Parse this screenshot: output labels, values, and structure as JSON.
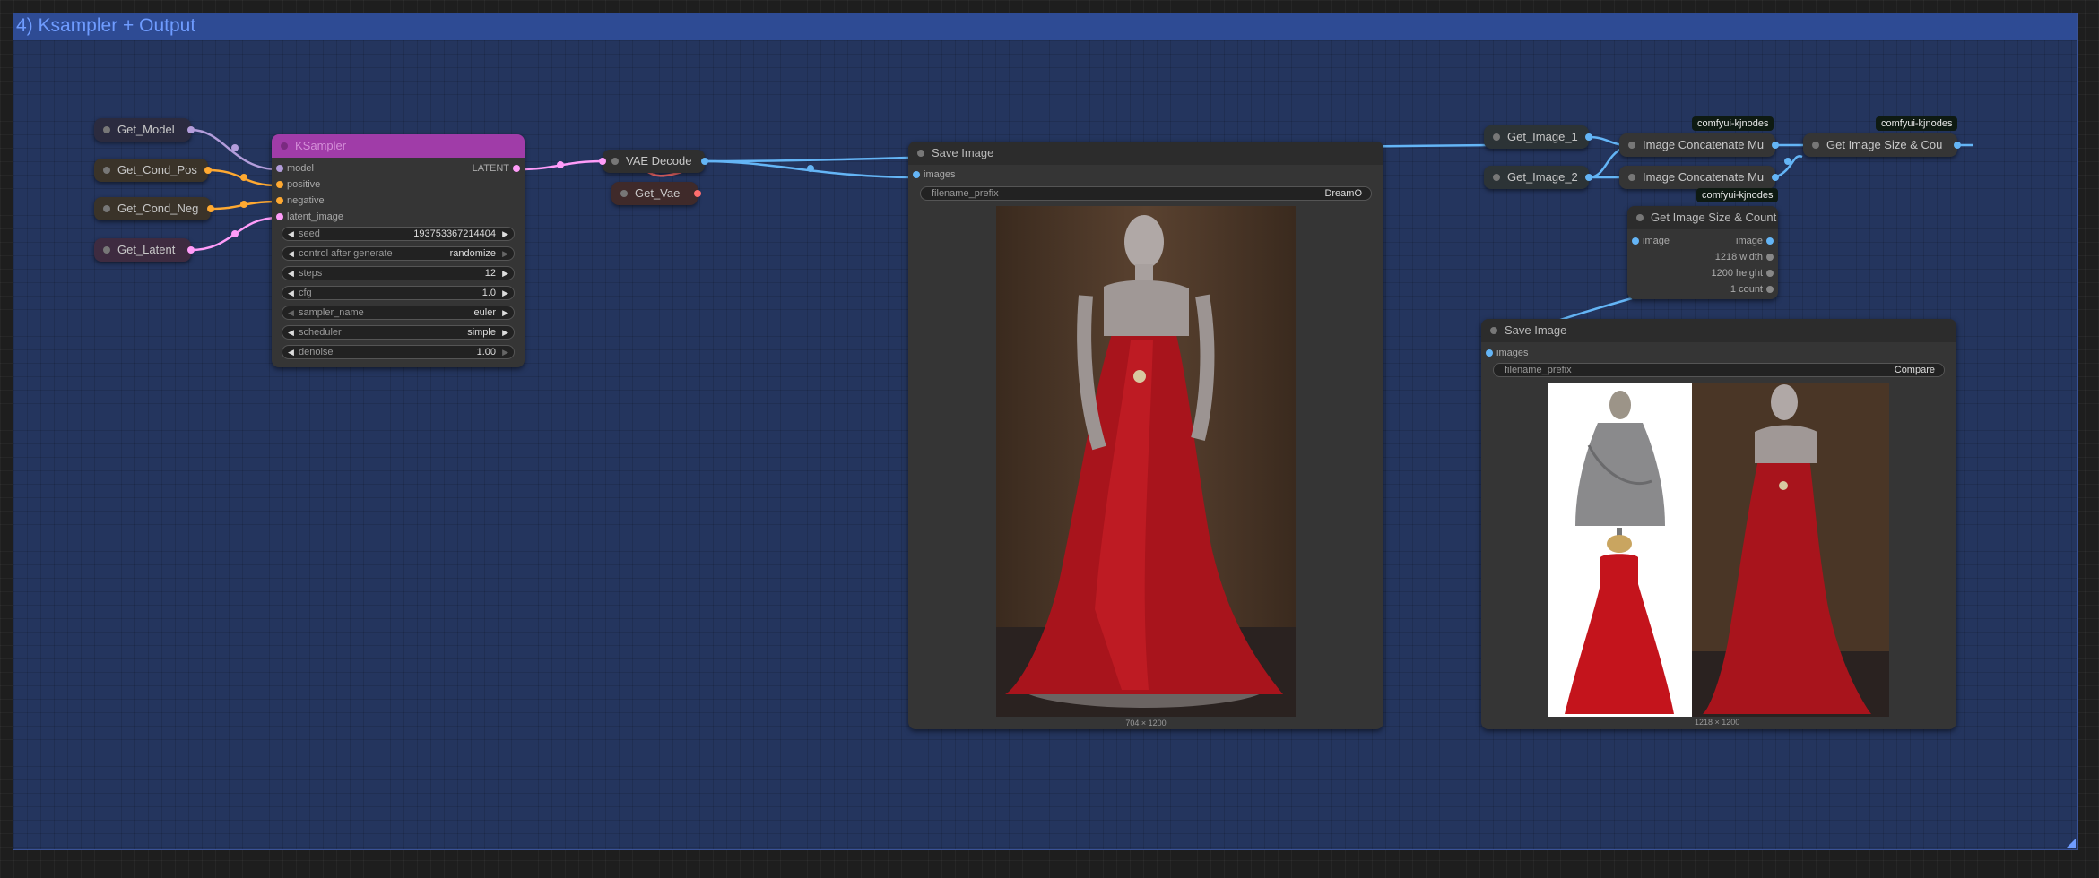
{
  "group": {
    "title": "4) Ksampler + Output"
  },
  "get_nodes": {
    "model": "Get_Model",
    "cond_pos": "Get_Cond_Pos",
    "cond_neg": "Get_Cond_Neg",
    "latent": "Get_Latent",
    "vae": "Get_Vae",
    "image1": "Get_Image_1",
    "image2": "Get_Image_2"
  },
  "ksampler": {
    "title": "KSampler",
    "inputs": [
      "model",
      "positive",
      "negative",
      "latent_image"
    ],
    "output": "LATENT",
    "widgets": [
      {
        "label": "seed",
        "value": "193753367214404"
      },
      {
        "label": "control after generate",
        "value": "randomize"
      },
      {
        "label": "steps",
        "value": "12"
      },
      {
        "label": "cfg",
        "value": "1.0"
      },
      {
        "label": "sampler_name",
        "value": "euler"
      },
      {
        "label": "scheduler",
        "value": "simple"
      },
      {
        "label": "denoise",
        "value": "1.00"
      }
    ]
  },
  "vae_decode": {
    "title": "VAE Decode"
  },
  "save_image_1": {
    "title": "Save Image",
    "input": "images",
    "prefix_label": "filename_prefix",
    "prefix_value": "DreamO",
    "dims": "704 × 1200"
  },
  "concat_1": {
    "title": "Image Concatenate Mu",
    "tag": "comfyui-kjnodes"
  },
  "concat_2": {
    "title": "Image Concatenate Mu"
  },
  "size_count_1": {
    "title": "Get Image Size & Cou",
    "tag": "comfyui-kjnodes"
  },
  "size_count_2": {
    "title": "Get Image Size & Count",
    "tag": "comfyui-kjnodes",
    "input": "image",
    "outputs": [
      "image",
      "1218 width",
      "1200 height",
      "1 count"
    ]
  },
  "save_image_2": {
    "title": "Save Image",
    "input": "images",
    "prefix_label": "filename_prefix",
    "prefix_value": "Compare",
    "dims": "1218 × 1200"
  },
  "colors": {
    "model_wire": "#b39ddb",
    "cond_wire": "#ffa931",
    "latent_wire": "#ff9cf9",
    "image_wire": "#64b5f6",
    "vae_wire": "#ff6e6e",
    "ksampler_header": "#a03ca8",
    "group_bg": "#24355e"
  }
}
